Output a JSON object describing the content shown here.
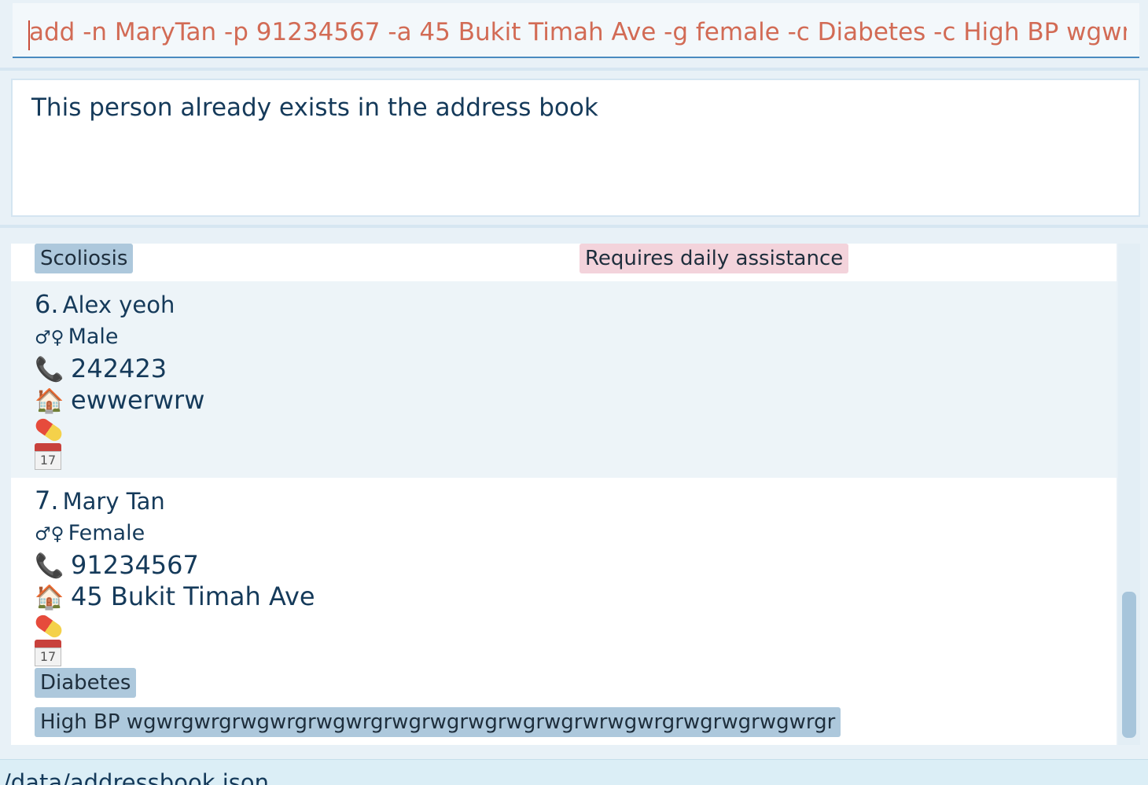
{
  "command_box": {
    "value": "add -n MaryTan -p 91234567 -a 45 Bukit Timah Ave -g female -c Diabetes -c High BP wgwrgwrgrwgwrgrwgwrgrwgrwgrwgrwgrwgrwrwgwrgrwgrwgrwgwrgr"
  },
  "result_box": {
    "message": "This person already exists in the address book"
  },
  "list": {
    "partial_card": {
      "tags": [
        "Scoliosis",
        "Requires daily assistance"
      ]
    },
    "cards": [
      {
        "index": "6.",
        "name": "Alex yeoh",
        "gender_icon": "♂♀",
        "gender": "Male",
        "phone_icon": "📞",
        "phone": "242423",
        "address_icon": "🏠",
        "address": "ewwerwrw",
        "medication_icon": "pill-icon",
        "appointment_icon": "calendar-icon",
        "calendar_day": "17",
        "tags": []
      },
      {
        "index": "7.",
        "name": "Mary Tan",
        "gender_icon": "♂♀",
        "gender": "Female",
        "phone_icon": "📞",
        "phone": "91234567",
        "address_icon": "🏠",
        "address": "45 Bukit Timah Ave",
        "medication_icon": "pill-icon",
        "appointment_icon": "calendar-icon",
        "calendar_day": "17",
        "tags": [
          "Diabetes",
          "High BP wgwrgwrgrwgwrgrwgwrgrwgrwgrwgrwgrwgrwrwgwrgrwgrwgrwgwrgr"
        ]
      }
    ]
  },
  "status_bar": {
    "path": "/data/addressbook.json"
  },
  "colors": {
    "command_text": "#d26b55",
    "primary_text": "#153a5a",
    "condition_tag": "#adc8dc",
    "care_tag": "#f3d3db"
  }
}
